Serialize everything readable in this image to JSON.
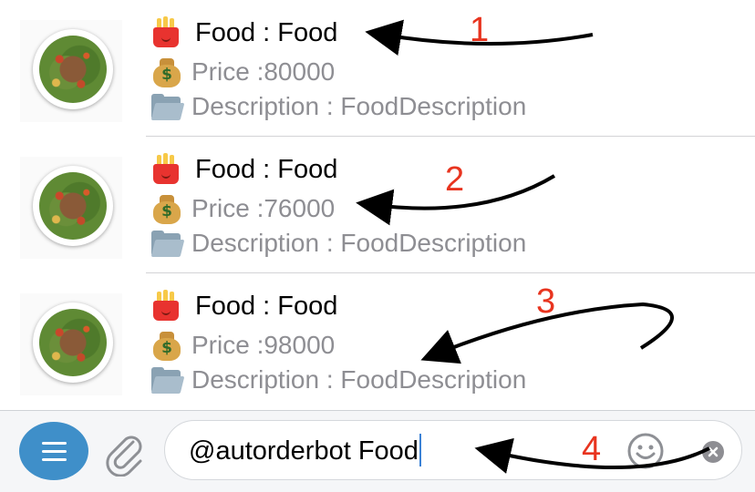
{
  "results": [
    {
      "title": "Food : Food",
      "price": "Price :80000",
      "description": "Description : FoodDescription"
    },
    {
      "title": "Food : Food",
      "price": "Price :76000",
      "description": "Description : FoodDescription"
    },
    {
      "title": "Food : Food",
      "price": "Price :98000",
      "description": "Description : FoodDescription"
    }
  ],
  "icons": {
    "title": "french-fries-icon",
    "price": "money-bag-icon",
    "description": "folder-icon",
    "menu": "menu-icon",
    "attach": "paperclip-icon",
    "emoji": "smiley-icon",
    "clear": "clear-icon"
  },
  "input": {
    "value": "@autorderbot Food"
  },
  "annotations": [
    "1",
    "2",
    "3",
    "4"
  ],
  "colors": {
    "accent": "#3f8fc9",
    "secondary_text": "#8e8e93",
    "annotation": "#e8341f",
    "caret": "#3b82d6"
  }
}
